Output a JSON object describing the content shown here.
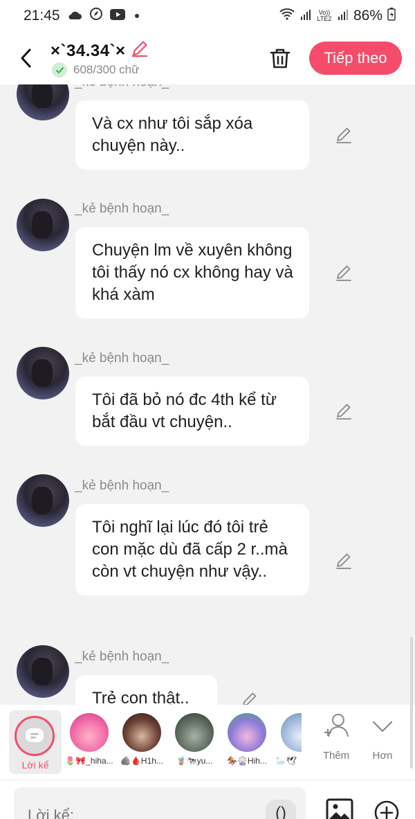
{
  "status_bar": {
    "time": "21:45",
    "battery": "86%",
    "network_label": "Vo)) LTE2"
  },
  "header": {
    "title": "×`34.34`×",
    "word_count": "608/300 chữ",
    "next_label": "Tiếp theo",
    "accent_color": "#f44c6a"
  },
  "messages": [
    {
      "author": "_kẻ bệnh hoạn_",
      "text": "Và cx như tôi sắp xóa chuyện này.."
    },
    {
      "author": "_kẻ bệnh hoạn_",
      "text": "Chuyện lm về xuyên không tôi thấy nó cx không hay và khá xàm"
    },
    {
      "author": "_kẻ bệnh hoạn_",
      "text": "Tôi đã bỏ nó đc 4th kể từ bắt đầu vt chuyện.."
    },
    {
      "author": "_kẻ bệnh hoạn_",
      "text": "Tôi nghĩ lại lúc đó tôi trẻ con mặc dù đã cấp 2 r..mà còn vt chuyện như vậy.."
    },
    {
      "author": "_kẻ bệnh hoạn_",
      "text": "Trẻ con thật.."
    }
  ],
  "characters": {
    "narrator_label": "Lời kể",
    "items": [
      {
        "name": "🌷🎀_hiha...",
        "color": "#f06aa8"
      },
      {
        "name": "🪨🩸H1h...",
        "color": "#6b3f34"
      },
      {
        "name": "🧋🐄yu...",
        "color": "#5d6a5e"
      },
      {
        "name": "🏇🎡Hih...",
        "color": "#8a7ad8"
      },
      {
        "name": "🦢🕊",
        "color": "#9bb4d9"
      }
    ],
    "add_label": "Thêm",
    "more_label": "Hơn"
  },
  "input": {
    "placeholder": "Lời kể:",
    "paren_label": "()"
  }
}
